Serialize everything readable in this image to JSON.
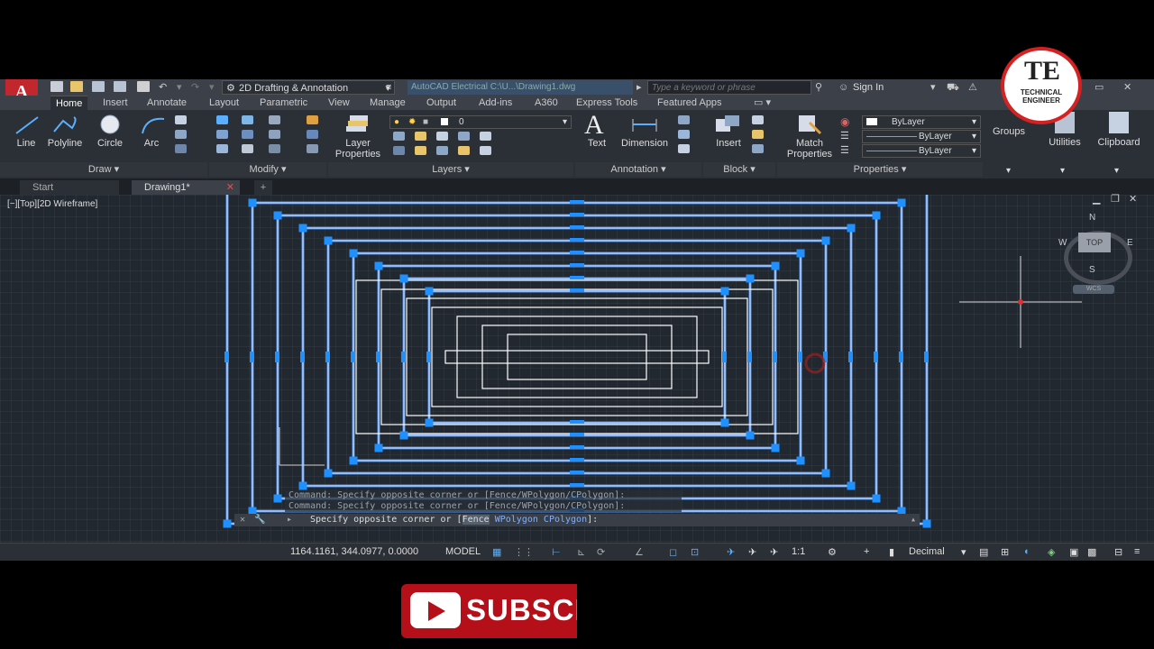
{
  "titlebar": {
    "app_logo": "A",
    "workspace": "2D Drafting & Annotation",
    "app_title": "AutoCAD Electrical    C:\\U...\\Drawing1.dwg",
    "search_placeholder": "Type a keyword or phrase",
    "sign_in": "Sign In"
  },
  "ribbon_tabs": [
    {
      "label": "Home"
    },
    {
      "label": "Insert"
    },
    {
      "label": "Annotate"
    },
    {
      "label": "Layout"
    },
    {
      "label": "Parametric"
    },
    {
      "label": "View"
    },
    {
      "label": "Manage"
    },
    {
      "label": "Output"
    },
    {
      "label": "Add-ins"
    },
    {
      "label": "A360"
    },
    {
      "label": "Express Tools"
    },
    {
      "label": "Featured Apps"
    }
  ],
  "ribbon": {
    "draw": {
      "line": "Line",
      "polyline": "Polyline",
      "circle": "Circle",
      "arc": "Arc",
      "title": "Draw"
    },
    "modify": {
      "title": "Modify"
    },
    "layers": {
      "layer_properties_1": "Layer",
      "layer_properties_2": "Properties",
      "current_layer": "0",
      "title": "Layers"
    },
    "annotation": {
      "text": "Text",
      "dimension": "Dimension",
      "title": "Annotation"
    },
    "block": {
      "insert": "Insert",
      "title": "Block"
    },
    "properties": {
      "match_1": "Match",
      "match_2": "Properties",
      "color": "ByLayer",
      "linetype": "ByLayer",
      "lineweight": "ByLayer",
      "title": "Properties"
    },
    "groups": "Groups",
    "utilities": "Utilities",
    "clipboard": "Clipboard"
  },
  "doc_tabs": {
    "start": "Start",
    "drawing": "Drawing1*"
  },
  "viewport": {
    "label": "[−][Top][2D Wireframe]",
    "viewcube": {
      "n": "N",
      "s": "S",
      "e": "E",
      "w": "W",
      "top": "TOP",
      "wcs": "WCS"
    }
  },
  "command": {
    "history_1": "Command: Specify opposite corner or [Fence/WPolygon/CPolygon]:",
    "history_2": "Command: Specify opposite corner or [Fence/WPolygon/CPolygon]:",
    "prompt_prefix": "Specify opposite corner or [",
    "opt_fence": "Fence",
    "opt_wpolygon": "WPolygon",
    "opt_cpolygon": "CPolygon",
    "prompt_suffix": "]:"
  },
  "status": {
    "coords": "1164.1161, 344.0977, 0.0000",
    "model": "MODEL",
    "scale": "1:1",
    "units": "Decimal"
  },
  "overlay": {
    "subscribe": "SUBSCR",
    "channel": "TECHNICAL ENGINEER",
    "channel_short": "TE"
  },
  "colors": {
    "selection": "#4f8fe8",
    "grip": "#1e90ff",
    "geometry": "#ffffff",
    "accent_red": "#c1272d"
  }
}
